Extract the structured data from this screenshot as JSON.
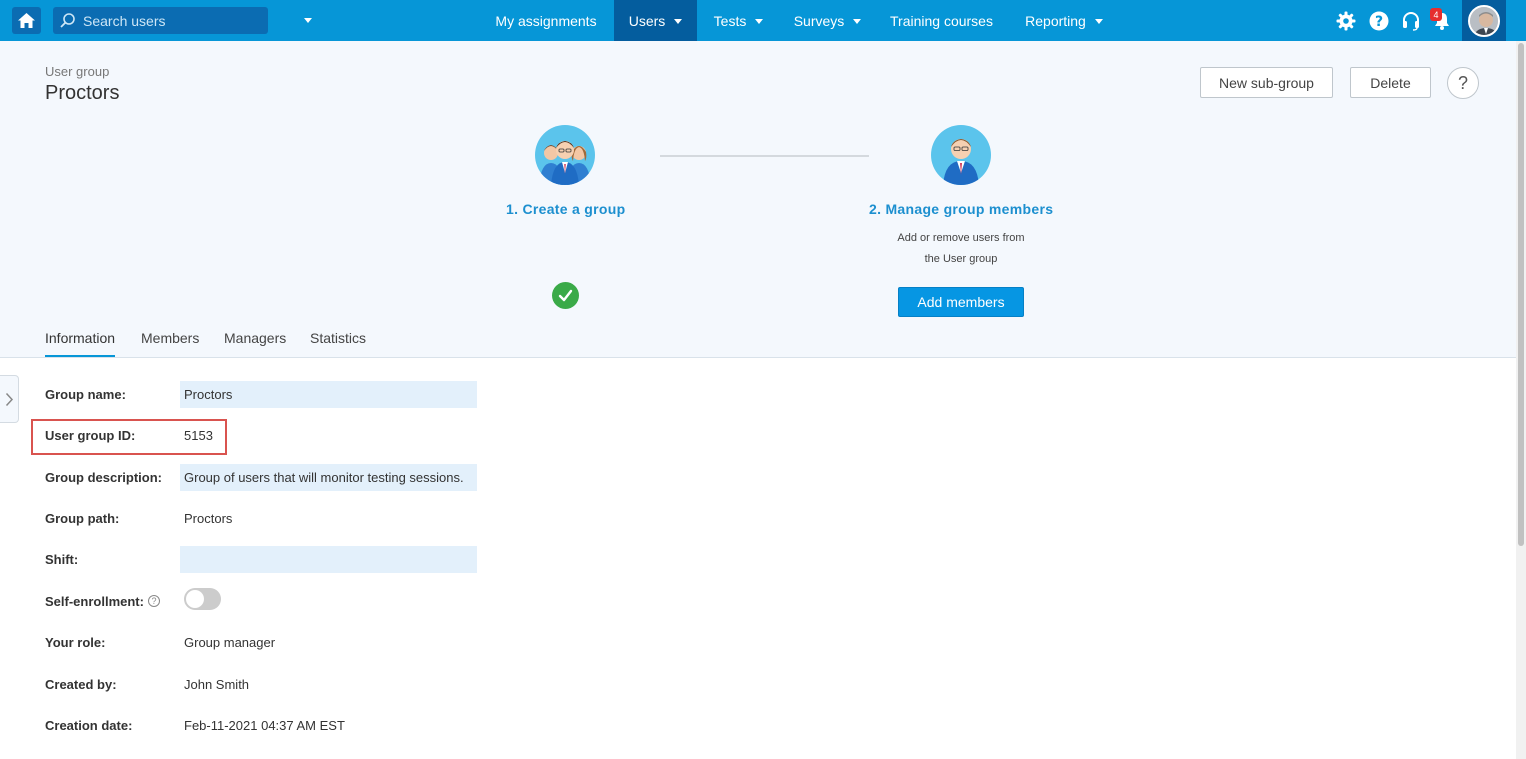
{
  "search": {
    "placeholder": "Search users"
  },
  "nav": {
    "my_assignments": "My assignments",
    "users": "Users",
    "tests": "Tests",
    "surveys": "Surveys",
    "training_courses": "Training courses",
    "reporting": "Reporting"
  },
  "notifications": {
    "count": "4"
  },
  "header": {
    "breadcrumb": "User group",
    "title": "Proctors",
    "new_subgroup_label": "New sub-group",
    "delete_label": "Delete",
    "help_label": "?"
  },
  "steps": {
    "step1_title": "1. Create a group",
    "step2_title": "2. Manage group members",
    "step2_desc_line1": "Add or remove users from",
    "step2_desc_line2": "the User group",
    "add_members_label": "Add members"
  },
  "tabs": {
    "information": "Information",
    "members": "Members",
    "managers": "Managers",
    "statistics": "Statistics"
  },
  "form": {
    "group_name_label": "Group name:",
    "group_name_value": "Proctors",
    "group_id_label": "User group ID:",
    "group_id_value": "5153",
    "group_description_label": "Group description:",
    "group_description_value": "Group of users that will monitor testing sessions.",
    "group_path_label": "Group path:",
    "group_path_value": "Proctors",
    "shift_label": "Shift:",
    "shift_value": "",
    "self_enrollment_label": "Self-enrollment:",
    "self_enrollment_enabled": false,
    "your_role_label": "Your role:",
    "your_role_value": "Group manager",
    "created_by_label": "Created by:",
    "created_by_value": "John Smith",
    "creation_date_label": "Creation date:",
    "creation_date_value": "Feb-11-2021 04:37 AM EST"
  },
  "colors": {
    "topbar": "#0696d7",
    "active_nav": "#045d9e",
    "accent": "#1c8fcf",
    "success": "#3aaa48",
    "highlight": "#d9534f"
  }
}
